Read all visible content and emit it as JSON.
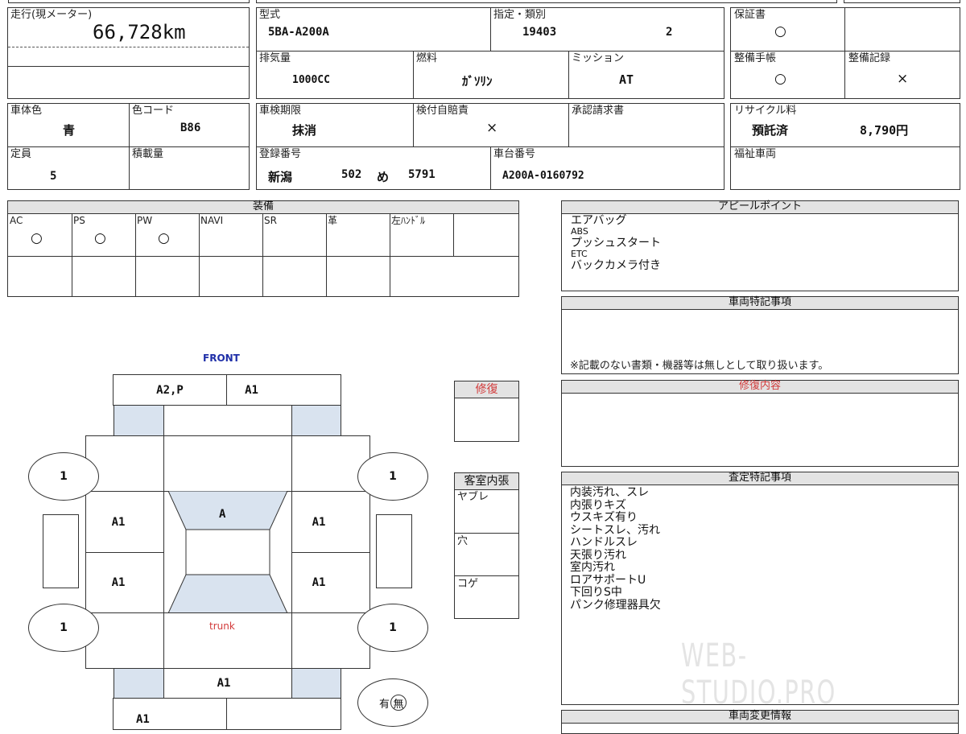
{
  "mileage": {
    "label": "走行(現メーター)",
    "value": "66,728km"
  },
  "model": {
    "label": "型式",
    "value": "5BA-A200A"
  },
  "designation": {
    "label": "指定・類別",
    "designation": "19403",
    "category": "2"
  },
  "warranty": {
    "label": "保証書",
    "value": "○"
  },
  "displacement": {
    "label": "排気量",
    "value": "1000CC"
  },
  "fuel": {
    "label": "燃料",
    "value": "ｶﾞｿﾘﾝ"
  },
  "mission": {
    "label": "ミッション",
    "value": "AT"
  },
  "maintenance_book": {
    "label": "整備手帳",
    "value": "○"
  },
  "maintenance_record": {
    "label": "整備記録",
    "value": "×"
  },
  "body_color": {
    "label": "車体色",
    "value": "青"
  },
  "color_code": {
    "label": "色コード",
    "value": "B86"
  },
  "inspection_expiry": {
    "label": "車検期限",
    "value": "抹消"
  },
  "liability_insurance": {
    "label": "検付自賠責",
    "value": "×"
  },
  "approval_request": {
    "label": "承認請求書"
  },
  "recycle": {
    "label": "リサイクル料",
    "status": "預託済",
    "amount": "8,790円"
  },
  "capacity": {
    "label": "定員",
    "value": "5"
  },
  "load_capacity": {
    "label": "積載量"
  },
  "registration": {
    "label": "登録番号",
    "region": "新潟",
    "class_no": "502",
    "kana": "め",
    "number": "5791"
  },
  "chassis": {
    "label": "車台番号",
    "value": "A200A-0160792"
  },
  "welfare": {
    "label": "福祉車両"
  },
  "equipment": {
    "title": "装備",
    "items": [
      {
        "label": "AC",
        "value": "○"
      },
      {
        "label": "PS",
        "value": "○"
      },
      {
        "label": "PW",
        "value": "○"
      },
      {
        "label": "NAVI",
        "value": ""
      },
      {
        "label": "SR",
        "value": ""
      },
      {
        "label": "革",
        "value": ""
      },
      {
        "label": "左ﾊﾝﾄﾞﾙ",
        "value": ""
      },
      {
        "label": "",
        "value": ""
      }
    ]
  },
  "appeal": {
    "title": "アピールポイント",
    "lines": [
      "エアバッグ",
      "ABS",
      "プッシュスタート",
      "ETC",
      "バックカメラ付き"
    ]
  },
  "special_notes": {
    "title": "車両特記事項",
    "note": "※記載のない書類・機器等は無しとして取り扱います。"
  },
  "repair_content": {
    "title": "修復内容"
  },
  "appraisal": {
    "title": "査定特記事項",
    "lines": [
      "内装汚れ、スレ",
      "内張りキズ",
      "ウスキズ有り",
      "シートスレ、汚れ",
      "ハンドルスレ",
      "天張り汚れ",
      "室内汚れ",
      "ロアサポートU",
      "下回りS中",
      "パンク修理器具欠"
    ]
  },
  "vehicle_change": {
    "title": "車両変更情報"
  },
  "repair": {
    "title": "修復"
  },
  "interior": {
    "title": "客室内張",
    "items": [
      "ヤブレ",
      "穴",
      "コゲ"
    ]
  },
  "diagram": {
    "front": "FRONT",
    "trunk": "trunk",
    "front_left": "A2,P",
    "front_right": "A1",
    "left_front": "A1",
    "left_rear": "A1",
    "right_front": "A1",
    "right_rear": "A1",
    "roof": "A",
    "tire_fl": "1",
    "tire_fr": "1",
    "tire_rl": "1",
    "tire_rr": "1",
    "rear_bumper": "A1",
    "rear_bottom": "A1",
    "spare_prefix": "有",
    "spare_mark": "無"
  },
  "colors": {
    "front_label": "#1f2fa8",
    "red_text": "#d23a3a",
    "header_bg": "#e3e3e3",
    "panel_fill": "#d9e3ef"
  },
  "watermark": "WEB-STUDIO.PRO"
}
